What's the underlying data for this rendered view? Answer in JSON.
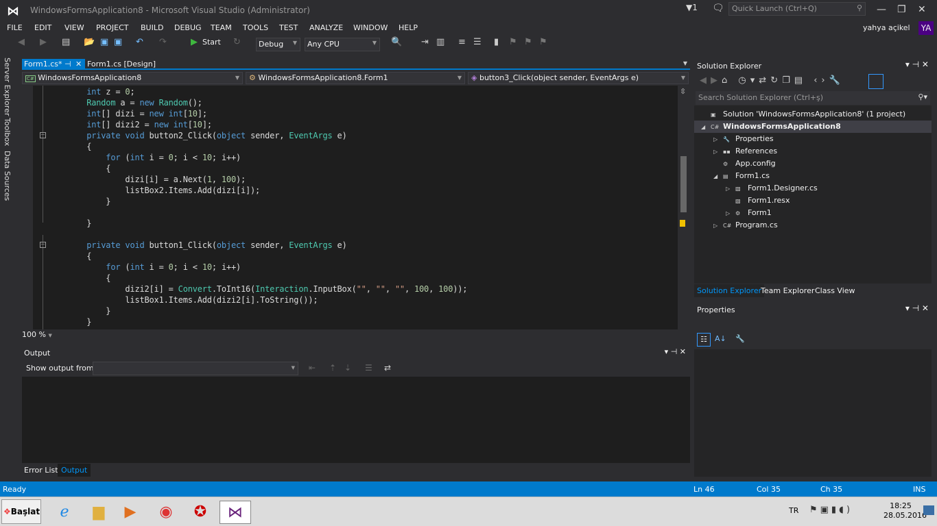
{
  "window": {
    "title": "WindowsFormsApplication8 - Microsoft Visual Studio (Administrator)",
    "notifications": "1",
    "quick_launch_placeholder": "Quick Launch (Ctrl+Q)",
    "user": "yahya açikel",
    "user_initials": "YA"
  },
  "menu": [
    "FILE",
    "EDIT",
    "VIEW",
    "PROJECT",
    "BUILD",
    "DEBUG",
    "TEAM",
    "TOOLS",
    "TEST",
    "ANALYZE",
    "WINDOW",
    "HELP"
  ],
  "toolbar": {
    "start_label": "Start",
    "config": "Debug",
    "platform": "Any CPU"
  },
  "side_tabs": [
    "Server Explorer",
    "Toolbox",
    "Data Sources"
  ],
  "tabs": [
    {
      "label": "Form1.cs*",
      "active": true
    },
    {
      "label": "Form1.cs [Design]",
      "active": false
    }
  ],
  "nav": {
    "project": "WindowsFormsApplication8",
    "class": "WindowsFormsApplication8.Form1",
    "member": "button3_Click(object sender, EventArgs e)"
  },
  "code": [
    [
      [
        "        "
      ],
      [
        "int",
        "kw"
      ],
      [
        " z = "
      ],
      [
        "0",
        "num"
      ],
      [
        ";"
      ]
    ],
    [
      [
        "        "
      ],
      [
        "Random",
        "ty"
      ],
      [
        " a = "
      ],
      [
        "new",
        "kw"
      ],
      [
        " "
      ],
      [
        "Random",
        "ty"
      ],
      [
        "();"
      ]
    ],
    [
      [
        "        "
      ],
      [
        "int",
        "kw"
      ],
      [
        "[] dizi = "
      ],
      [
        "new",
        "kw"
      ],
      [
        " "
      ],
      [
        "int",
        "kw"
      ],
      [
        "["
      ],
      [
        "10",
        "num"
      ],
      [
        "];"
      ]
    ],
    [
      [
        "        "
      ],
      [
        "int",
        "kw"
      ],
      [
        "[] dizi2 = "
      ],
      [
        "new",
        "kw"
      ],
      [
        " "
      ],
      [
        "int",
        "kw"
      ],
      [
        "["
      ],
      [
        "10",
        "num"
      ],
      [
        "];"
      ]
    ],
    [
      [
        "        "
      ],
      [
        "private",
        "kw"
      ],
      [
        " "
      ],
      [
        "void",
        "kw"
      ],
      [
        " button2_Click("
      ],
      [
        "object",
        "kw"
      ],
      [
        " sender, "
      ],
      [
        "EventArgs",
        "ty"
      ],
      [
        " e)"
      ]
    ],
    [
      [
        "        {"
      ]
    ],
    [
      [
        "            "
      ],
      [
        "for",
        "kw"
      ],
      [
        " ("
      ],
      [
        "int",
        "kw"
      ],
      [
        " i = "
      ],
      [
        "0",
        "num"
      ],
      [
        "; i < "
      ],
      [
        "10",
        "num"
      ],
      [
        "; i++)"
      ]
    ],
    [
      [
        "            {"
      ]
    ],
    [
      [
        "                dizi[i] = a.Next("
      ],
      [
        "1",
        "num"
      ],
      [
        ", "
      ],
      [
        "100",
        "num"
      ],
      [
        ");"
      ]
    ],
    [
      [
        "                listBox2.Items.Add(dizi[i]);"
      ]
    ],
    [
      [
        "            }"
      ]
    ],
    [
      [
        ""
      ]
    ],
    [
      [
        "        }"
      ]
    ],
    [
      [
        ""
      ]
    ],
    [
      [
        "        "
      ],
      [
        "private",
        "kw"
      ],
      [
        " "
      ],
      [
        "void",
        "kw"
      ],
      [
        " button1_Click("
      ],
      [
        "object",
        "kw"
      ],
      [
        " sender, "
      ],
      [
        "EventArgs",
        "ty"
      ],
      [
        " e)"
      ]
    ],
    [
      [
        "        {"
      ]
    ],
    [
      [
        "            "
      ],
      [
        "for",
        "kw"
      ],
      [
        " ("
      ],
      [
        "int",
        "kw"
      ],
      [
        " i = "
      ],
      [
        "0",
        "num"
      ],
      [
        "; i < "
      ],
      [
        "10",
        "num"
      ],
      [
        "; i++)"
      ]
    ],
    [
      [
        "            {"
      ]
    ],
    [
      [
        "                dizi2[i] = "
      ],
      [
        "Convert",
        "ty"
      ],
      [
        ".ToInt16("
      ],
      [
        "Interaction",
        "ty"
      ],
      [
        ".InputBox("
      ],
      [
        "\"\"",
        "str"
      ],
      [
        ", "
      ],
      [
        "\"\"",
        "str"
      ],
      [
        ", "
      ],
      [
        "\"\"",
        "str"
      ],
      [
        ", "
      ],
      [
        "100",
        "num"
      ],
      [
        ", "
      ],
      [
        "100",
        "num"
      ],
      [
        "));"
      ]
    ],
    [
      [
        "                listBox1.Items.Add(dizi2[i].ToString());"
      ]
    ],
    [
      [
        "            }"
      ]
    ],
    [
      [
        "        }"
      ]
    ]
  ],
  "editor": {
    "zoom": "100 %"
  },
  "output": {
    "title": "Output",
    "show_from_label": "Show output from:",
    "source": ""
  },
  "bottom_tabs": [
    {
      "label": "Error List",
      "active": false
    },
    {
      "label": "Output",
      "active": true
    }
  ],
  "solution_explorer": {
    "title": "Solution Explorer",
    "search_placeholder": "Search Solution Explorer (Ctrl+ş)",
    "tree": [
      {
        "label": "Solution 'WindowsFormsApplication8' (1 project)",
        "level": 0,
        "expander": "",
        "icon": "solution-icon"
      },
      {
        "label": "WindowsFormsApplication8",
        "level": 0,
        "expander": "◢",
        "icon": "csharp-project-icon",
        "bold": true,
        "selected": true
      },
      {
        "label": "Properties",
        "level": 1,
        "expander": "▷",
        "icon": "wrench-icon"
      },
      {
        "label": "References",
        "level": 1,
        "expander": "▷",
        "icon": "references-icon"
      },
      {
        "label": "App.config",
        "level": 1,
        "expander": "",
        "icon": "config-icon"
      },
      {
        "label": "Form1.cs",
        "level": 1,
        "expander": "◢",
        "icon": "form-icon"
      },
      {
        "label": "Form1.Designer.cs",
        "level": 2,
        "expander": "▷",
        "icon": "cs-file-icon"
      },
      {
        "label": "Form1.resx",
        "level": 2,
        "expander": "",
        "icon": "resx-icon"
      },
      {
        "label": "Form1",
        "level": 2,
        "expander": "▷",
        "icon": "class-icon"
      },
      {
        "label": "Program.cs",
        "level": 1,
        "expander": "▷",
        "icon": "csharp-file-icon"
      }
    ],
    "tabs": [
      {
        "label": "Solution Explorer",
        "active": true
      },
      {
        "label": "Team Explorer",
        "active": false
      },
      {
        "label": "Class View",
        "active": false
      }
    ]
  },
  "properties": {
    "title": "Properties"
  },
  "status": {
    "text": "Ready",
    "ln": "Ln 46",
    "col": "Col 35",
    "ch": "Ch 35",
    "mode": "INS"
  },
  "taskbar": {
    "start": "Başlat",
    "lang": "TR",
    "time": "18:25",
    "date": "28.05.2016"
  },
  "colors": {
    "accent": "#007acc",
    "editor_bg": "#1e1e1e",
    "chrome_bg": "#2d2d30",
    "keyword": "#569cd6",
    "type": "#4ec9b0",
    "number": "#b5cea8"
  }
}
